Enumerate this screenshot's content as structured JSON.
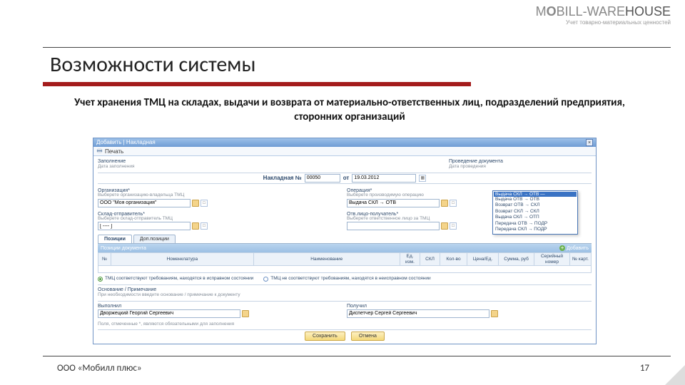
{
  "logo": {
    "text": "MOBILL-WAREHOUSE",
    "subtitle": "Учет товарно-материальных ценностей"
  },
  "page": {
    "title": "Возможности системы",
    "subtitle": "Учет хранения ТМЦ на складах, выдачи и возврата от материально-ответственных лиц, подразделений предприятия, сторонних организаций"
  },
  "win": {
    "title": "Добавить | Накладная",
    "print": "Печать",
    "topright_label1": "Проведение документа",
    "topright_label2": "Дата проведения",
    "topleft_label1": "Заполнение",
    "topleft_label2": "Дата заполнения",
    "docnum_label": "Накладная №",
    "docnum_value": "00050",
    "ot": "от",
    "date": "19.03.2012",
    "org_label": "Организация*",
    "org_hint": "Выберете организацию-владельца ТМЦ",
    "org_value": "ООО \"Моя организация\"",
    "skl_label": "Склад-отправитель*",
    "skl_hint": "Выберете склад-отправитель ТМЦ",
    "skl_value": "[ ---- ]",
    "op_label": "Операция*",
    "op_hint": "Выберете производимую операцию",
    "otv_label": "Отв.лицо-получатель*",
    "otv_hint": "Выберете ответственное лицо за ТМЦ",
    "popup_selected": "Выдача СКЛ → ОТВ",
    "popup_items": [
      "Выдача СКЛ → ОТВ —",
      "Выдача ОТВ → ОТВ",
      "Возврат ОТВ → СКЛ",
      "Возврат СКЛ → СКЛ",
      "Выдача СКЛ → ОТП",
      "Передача ОТВ → ПОДР",
      "Передача СКЛ → ПОДР"
    ],
    "tabs": [
      "Позиции",
      "Доп.позиции"
    ],
    "grid_title": "Позиции документа",
    "add_btn": "Добавить",
    "columns": [
      "№",
      "Номенклатура",
      "Наименование",
      "Ед. изм.",
      "СКЛ",
      "Кол-во",
      "Цена/Ед.",
      "Сумма, руб",
      "Серийный номер",
      "№ карт."
    ],
    "radio_on": "ТМЦ соответствуют требованиям, находятся в исправном состоянии",
    "radio_off": "ТМЦ не соответствуют требованиям, находятся в неисправном состоянии",
    "osn_label": "Основание / Примечание",
    "osn_hint": "При необходимости введите основание / примечание к документу",
    "vyp_label": "Выполнил",
    "vyp_value": "Дворжецкий Георгий Сергеевич",
    "pol_label": "Получил",
    "pol_value": "Диспетчер Сергей Сергеевич",
    "bot_hint": "Поля, отмеченные *, являются обязательными для заполнения",
    "btn_save": "Сохранить",
    "btn_cancel": "Отмена"
  },
  "footer": {
    "company": "ООО «Мобилл плюс»",
    "page": "17"
  }
}
